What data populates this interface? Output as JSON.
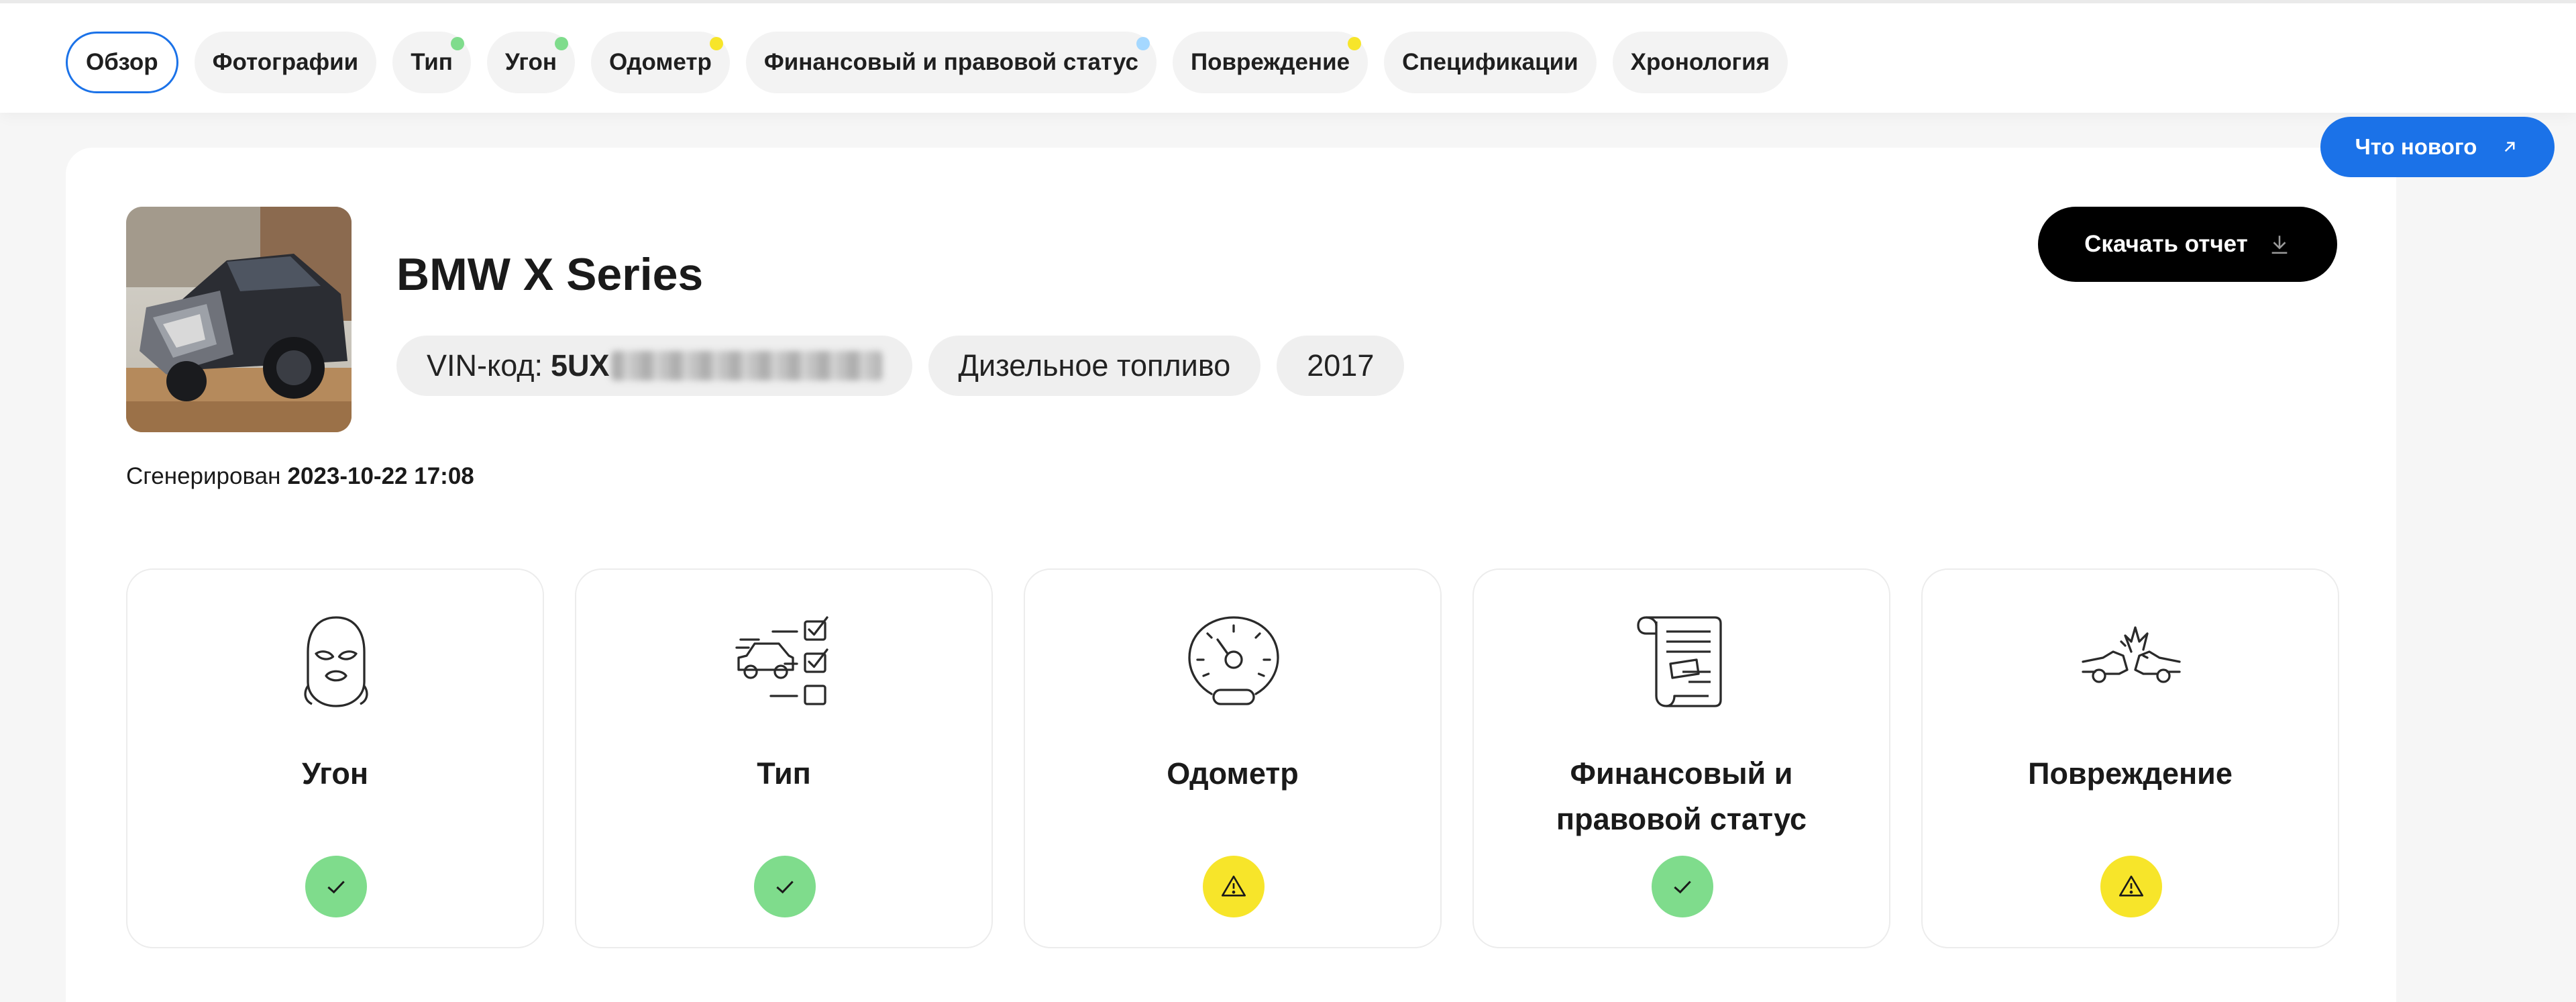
{
  "nav": {
    "tabs": [
      {
        "label": "Обзор",
        "active": true,
        "dot": null
      },
      {
        "label": "Фотографии",
        "active": false,
        "dot": null
      },
      {
        "label": "Тип",
        "active": false,
        "dot": "#7fdc8c"
      },
      {
        "label": "Угон",
        "active": false,
        "dot": "#7fdc8c"
      },
      {
        "label": "Одометр",
        "active": false,
        "dot": "#f7e52a"
      },
      {
        "label": "Финансовый и правовой статус",
        "active": false,
        "dot": "#a5d8ff"
      },
      {
        "label": "Повреждение",
        "active": false,
        "dot": "#f7e52a"
      },
      {
        "label": "Спецификации",
        "active": false,
        "dot": null
      },
      {
        "label": "Хронология",
        "active": false,
        "dot": null
      }
    ],
    "whats_new_label": "Что нового"
  },
  "report": {
    "title": "BMW X Series",
    "vin_label": "VIN-код:",
    "vin_visible": "5UX",
    "fuel": "Дизельное топливо",
    "year": "2017",
    "download_label": "Скачать отчет",
    "generated_label": "Сгенерирован",
    "generated_at": "2023-10-22 17:08"
  },
  "tiles": [
    {
      "label": "Угон",
      "icon": "balaclava-icon",
      "status": "ok"
    },
    {
      "label": "Тип",
      "icon": "car-checklist-icon",
      "status": "ok"
    },
    {
      "label": "Одометр",
      "icon": "speedometer-icon",
      "status": "warning"
    },
    {
      "label": "Финансовый и правовой статус",
      "icon": "legal-scroll-icon",
      "status": "ok"
    },
    {
      "label": "Повреждение",
      "icon": "car-crash-icon",
      "status": "warning"
    }
  ],
  "colors": {
    "accent": "#1b72e8",
    "ok": "#7fdc8c",
    "warning": "#f7e52a",
    "info": "#a5d8ff"
  }
}
